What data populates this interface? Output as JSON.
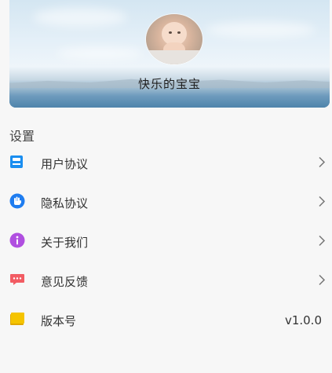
{
  "profile": {
    "username": "快乐的宝宝"
  },
  "settings": {
    "section_title": "设置",
    "items": [
      {
        "label": "用户协议",
        "icon": "user-agreement-icon",
        "color": "#1a8ef0"
      },
      {
        "label": "隐私协议",
        "icon": "privacy-hand-icon",
        "color": "#1f7df0"
      },
      {
        "label": "关于我们",
        "icon": "info-icon",
        "color": "#b04fe0"
      },
      {
        "label": "意见反馈",
        "icon": "feedback-chat-icon",
        "color": "#f25c63"
      },
      {
        "label": "版本号",
        "icon": "version-note-icon",
        "color": "#f5c400",
        "value": "v1.0.0"
      }
    ]
  }
}
